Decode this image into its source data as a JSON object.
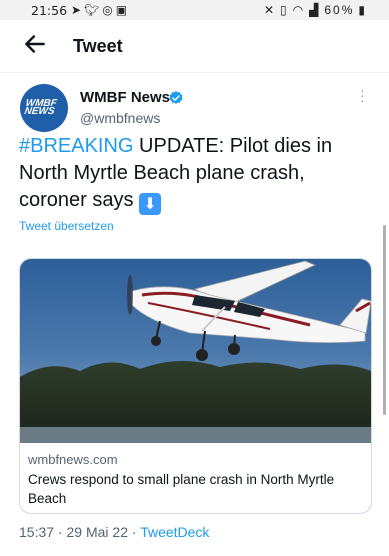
{
  "status_bar": {
    "time": "21:56",
    "battery": "60%",
    "icons_left": [
      "send-icon",
      "twitter-icon",
      "whatsapp-icon",
      "image-icon"
    ],
    "icons_right": [
      "mute-icon",
      "lock-icon",
      "wifi-icon",
      "signal-icon",
      "battery-icon"
    ]
  },
  "app_bar": {
    "title": "Tweet",
    "back_icon": "arrow-left-icon"
  },
  "tweet": {
    "author": {
      "name": "WMBF News",
      "handle": "@wmbfnews",
      "avatar_text_line1": "WMBF",
      "avatar_text_line2": "NEWS",
      "verified": true
    },
    "hashtag": "#BREAKING",
    "text": " UPDATE: Pilot dies in North Myrtle Beach plane crash, coroner says ",
    "emoji": "⬇",
    "translate_label": "Tweet übersetzen",
    "card": {
      "domain": "wmbfnews.com",
      "title": "Crews respond to small plane crash in North Myrtle Beach",
      "image_description_icon": "plane-photo"
    },
    "time": "15:37",
    "date": "29 Mai 22",
    "separator": " · ",
    "source": "TweetDeck"
  },
  "colors": {
    "accent": "#1d9bf0",
    "text": "#0f1419",
    "secondary": "#536471",
    "avatar_bg": "#1f5ea8"
  }
}
